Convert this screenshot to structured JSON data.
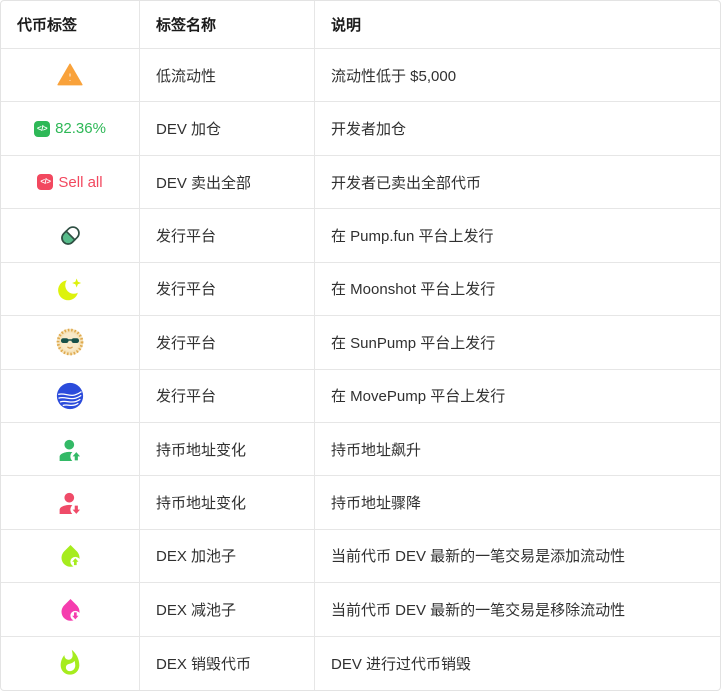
{
  "table": {
    "headers": [
      "代币标签",
      "标签名称",
      "说明"
    ],
    "rows": [
      {
        "icon": "warning-triangle-icon",
        "name": "低流动性",
        "desc": "流动性低于 $5,000"
      },
      {
        "icon": "dev-code-icon",
        "badge_text": "82.36%",
        "name": "DEV 加仓",
        "desc": "开发者加仓"
      },
      {
        "icon": "dev-code-icon",
        "badge_text": "Sell all",
        "name": "DEV 卖出全部",
        "desc": "开发者已卖出全部代币"
      },
      {
        "icon": "pump-fun-pill-icon",
        "name": "发行平台",
        "desc": "在 Pump.fun 平台上发行"
      },
      {
        "icon": "moonshot-moon-icon",
        "name": "发行平台",
        "desc": "在 Moonshot 平台上发行"
      },
      {
        "icon": "sunpump-sun-icon",
        "name": "发行平台",
        "desc": "在 SunPump 平台上发行"
      },
      {
        "icon": "movepump-globe-icon",
        "name": "发行平台",
        "desc": "在 MovePump 平台上发行"
      },
      {
        "icon": "holder-up-icon",
        "name": "持币地址变化",
        "desc": "持币地址飙升"
      },
      {
        "icon": "holder-down-icon",
        "name": "持币地址变化",
        "desc": "持币地址骤降"
      },
      {
        "icon": "pool-add-icon",
        "name": "DEX 加池子",
        "desc": "当前代币 DEV 最新的一笔交易是添加流动性"
      },
      {
        "icon": "pool-remove-icon",
        "name": "DEX 减池子",
        "desc": "当前代币 DEV 最新的一笔交易是移除流动性"
      },
      {
        "icon": "burn-flame-icon",
        "name": "DEX 销毁代币",
        "desc": "DEV 进行过代币销毁"
      }
    ],
    "icons": {
      "dev_code_glyph": "</>"
    },
    "colors": {
      "warning_orange": "#F9A23B",
      "dev_buy_green": "#2EB857",
      "dev_sell_pink": "#F2485F",
      "pump_fun_green": "#57BB8A",
      "moonshot_lime": "#DDF20D",
      "sunpump_gold": "#DFA94E",
      "movepump_blue": "#2B4BDB",
      "holder_up_green": "#33B966",
      "holder_down_pink": "#EF4B68",
      "pool_add_lime": "#A6EC1E",
      "pool_remove_pink": "#F53DAE",
      "burn_lime": "#A6EC1E",
      "border_gray": "#E6E6E6"
    }
  }
}
